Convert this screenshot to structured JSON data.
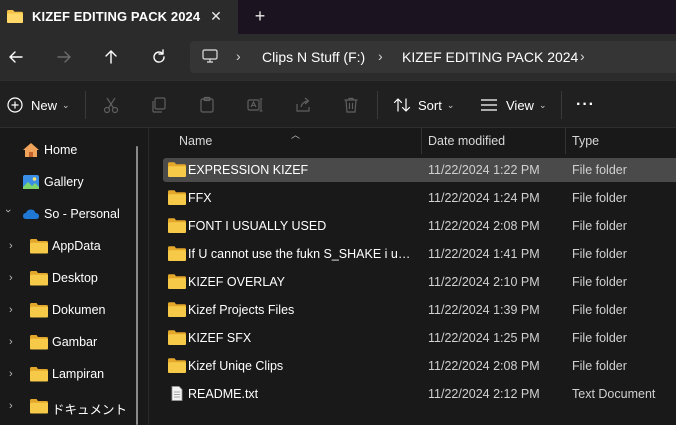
{
  "window": {
    "tab_title": "KIZEF EDITING PACK 2024",
    "close_glyph": "✕",
    "new_tab_glyph": "+"
  },
  "nav": {
    "breadcrumbs": [
      "Clips N Stuff (F:)",
      "KIZEF EDITING PACK 2024"
    ],
    "separator": "›"
  },
  "commands": {
    "new_label": "New",
    "sort_label": "Sort",
    "view_label": "View",
    "more_label": "···",
    "caret": "⌄"
  },
  "sidebar": {
    "items": [
      {
        "label": "Home",
        "icon": "home-icon"
      },
      {
        "label": "Gallery",
        "icon": "gallery-icon"
      },
      {
        "label": "So - Personal",
        "icon": "onedrive-cloud-icon"
      },
      {
        "label": "AppData",
        "icon": "folder-icon"
      },
      {
        "label": "Desktop",
        "icon": "folder-icon"
      },
      {
        "label": "Dokumen",
        "icon": "folder-icon"
      },
      {
        "label": "Gambar",
        "icon": "folder-icon"
      },
      {
        "label": "Lampiran",
        "icon": "folder-icon"
      },
      {
        "label": "ドキュメント",
        "icon": "folder-icon"
      }
    ]
  },
  "columns": {
    "name": "Name",
    "date": "Date modified",
    "type": "Type"
  },
  "files": [
    {
      "name": "EXPRESSION KIZEF",
      "date": "11/22/2024 1:22 PM",
      "type": "File folder",
      "selected": true
    },
    {
      "name": "FFX",
      "date": "11/22/2024 1:24 PM",
      "type": "File folder"
    },
    {
      "name": "FONT I USUALLY USED",
      "date": "11/22/2024 2:08 PM",
      "type": "File folder"
    },
    {
      "name": "If U cannot use the fukn S_SHAKE i usuall...",
      "date": "11/22/2024 1:41 PM",
      "type": "File folder"
    },
    {
      "name": "KIZEF OVERLAY",
      "date": "11/22/2024 2:10 PM",
      "type": "File folder"
    },
    {
      "name": "Kizef Projects Files",
      "date": "11/22/2024 1:39 PM",
      "type": "File folder"
    },
    {
      "name": "KIZEF SFX",
      "date": "11/22/2024 1:25 PM",
      "type": "File folder"
    },
    {
      "name": "Kizef Uniqe Clips",
      "date": "11/22/2024 2:08 PM",
      "type": "File folder"
    },
    {
      "name": "README.txt",
      "date": "11/22/2024 2:12 PM",
      "type": "Text Document"
    }
  ],
  "colors": {
    "folder": "#f4c247",
    "accent": "#4cc2ff",
    "selected_row": "#4a4a4a"
  }
}
